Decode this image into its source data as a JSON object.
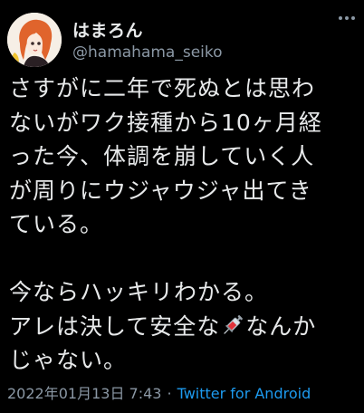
{
  "user": {
    "display_name": "はまろん",
    "handle": "@hamahama_seiko"
  },
  "tweet": {
    "lines": [
      "さすがに二年で死ぬとは思わ",
      "ないがワク接種から10ヶ月経",
      "った今、体調を崩していく人",
      "が周りにウジャウジャ出てき",
      "ている。",
      "今ならハッキリわかる。",
      "アレは決して安全な",
      "なんか",
      "じゃない。"
    ],
    "emoji": "syringe-icon"
  },
  "meta": {
    "timestamp": "2022年01月13日 7:43",
    "separator": "·",
    "source": "Twitter for Android"
  },
  "colors": {
    "background": "#000000",
    "text": "#e7e9ea",
    "secondary": "#8b98a5",
    "link": "#1d9bf0"
  }
}
